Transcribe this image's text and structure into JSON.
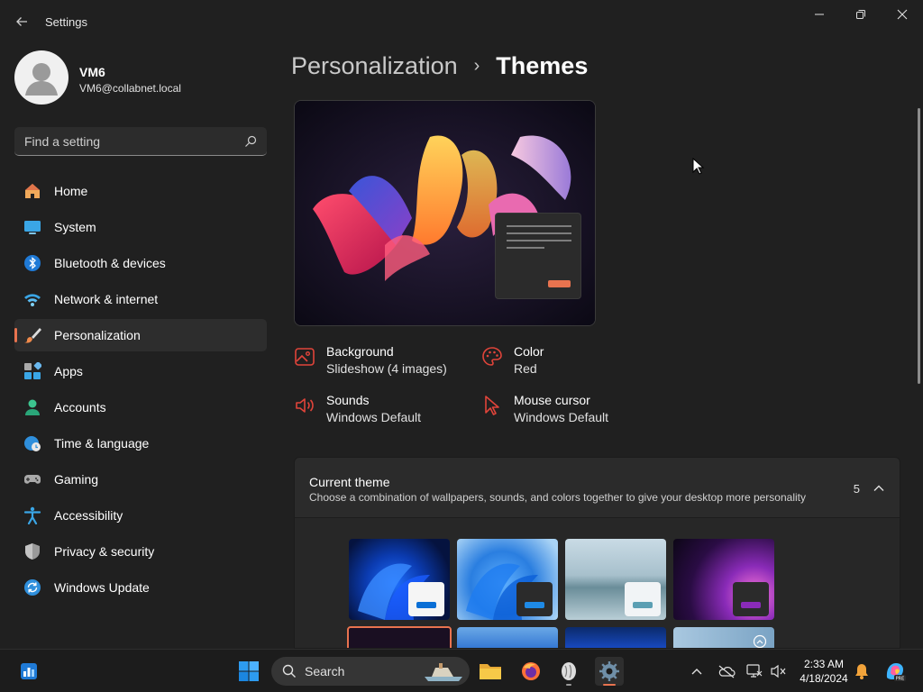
{
  "app": {
    "title": "Settings"
  },
  "profile": {
    "name": "VM6",
    "email": "VM6@collabnet.local"
  },
  "search": {
    "placeholder": "Find a setting"
  },
  "nav": {
    "items": [
      {
        "label": "Home",
        "icon": "home-icon"
      },
      {
        "label": "System",
        "icon": "system-icon"
      },
      {
        "label": "Bluetooth & devices",
        "icon": "bluetooth-icon"
      },
      {
        "label": "Network & internet",
        "icon": "wifi-icon"
      },
      {
        "label": "Personalization",
        "icon": "brush-icon",
        "active": true
      },
      {
        "label": "Apps",
        "icon": "apps-icon"
      },
      {
        "label": "Accounts",
        "icon": "accounts-icon"
      },
      {
        "label": "Time & language",
        "icon": "clock-globe-icon"
      },
      {
        "label": "Gaming",
        "icon": "gamepad-icon"
      },
      {
        "label": "Accessibility",
        "icon": "accessibility-icon"
      },
      {
        "label": "Privacy & security",
        "icon": "shield-icon"
      },
      {
        "label": "Windows Update",
        "icon": "update-icon"
      }
    ]
  },
  "breadcrumb": {
    "parent": "Personalization",
    "separator": "›",
    "current": "Themes"
  },
  "properties": {
    "background": {
      "title": "Background",
      "value": "Slideshow (4 images)"
    },
    "color": {
      "title": "Color",
      "value": "Red"
    },
    "sounds": {
      "title": "Sounds",
      "value": "Windows Default"
    },
    "cursor": {
      "title": "Mouse cursor",
      "value": "Windows Default"
    }
  },
  "current_theme": {
    "title": "Current theme",
    "description": "Choose a combination of wallpapers, sounds, and colors together to give your desktop more personality",
    "count": "5"
  },
  "taskbar": {
    "search_label": "Search",
    "time": "2:33 AM",
    "date": "4/18/2024"
  },
  "colors": {
    "accent": "#e8734f",
    "icon_red": "#e0443a",
    "background": "#202020"
  }
}
